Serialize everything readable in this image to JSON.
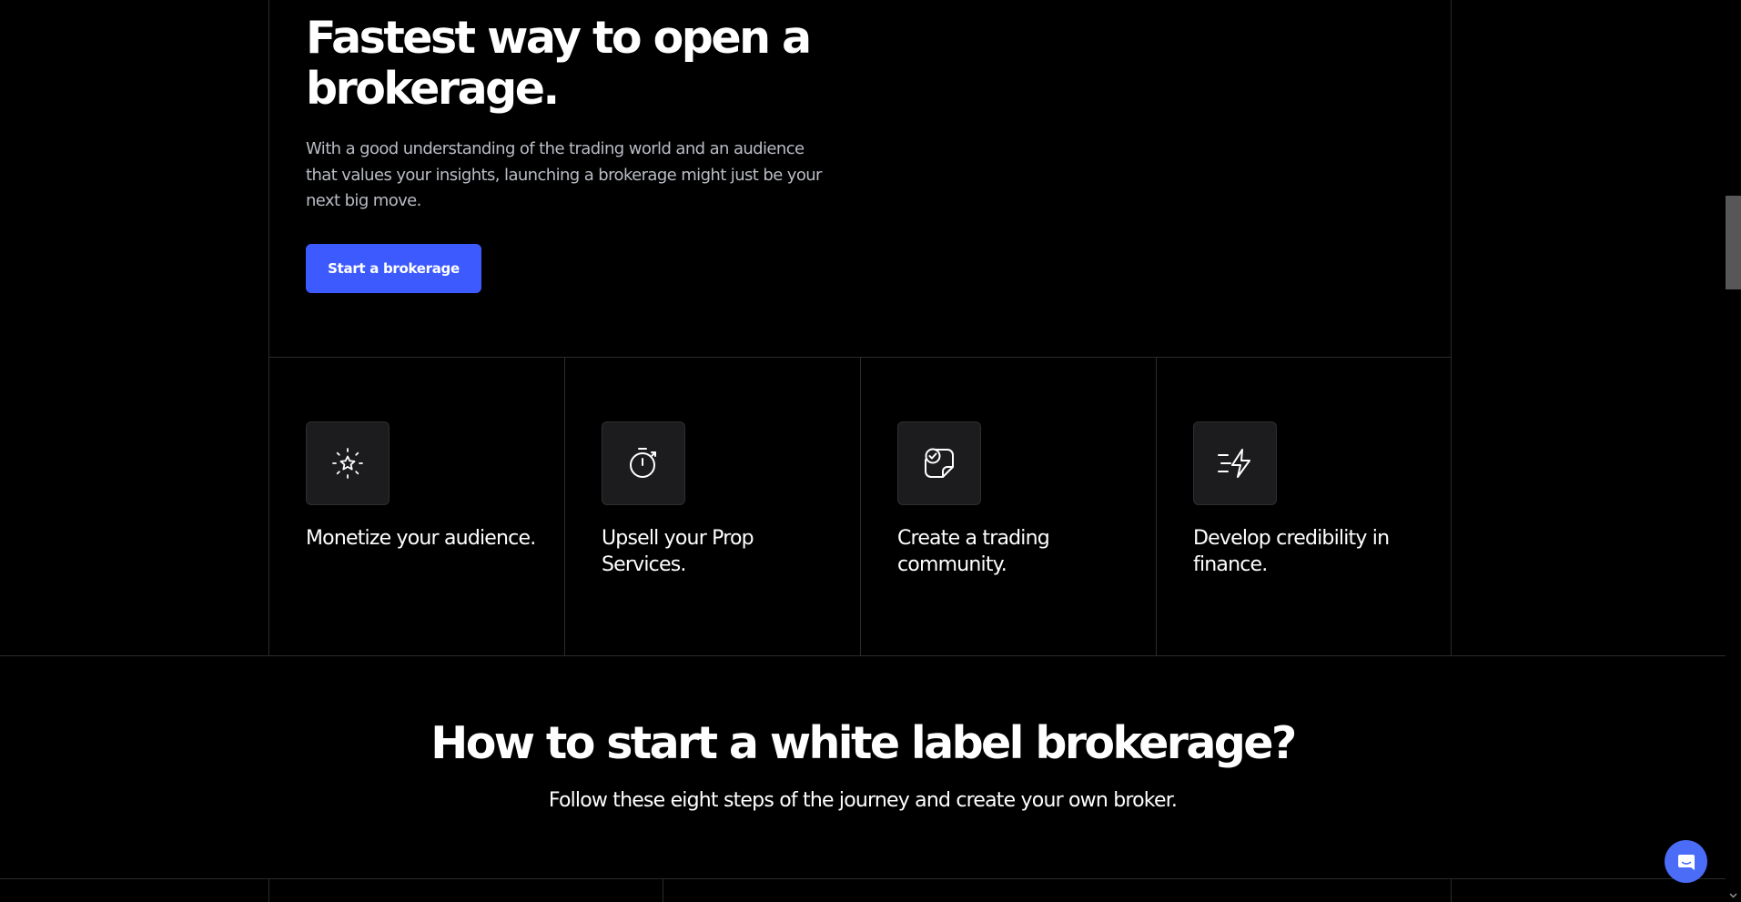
{
  "hero": {
    "title": "Fastest way to open a brokerage.",
    "description": "With a good understanding of the trading world and an audience that values your insights, launching a brokerage might just be your next big move.",
    "cta_label": "Start a brokerage"
  },
  "features": [
    {
      "icon": "sparkle-star-icon",
      "title": "Monetize your audience."
    },
    {
      "icon": "stopwatch-icon",
      "title": "Upsell your Prop Services."
    },
    {
      "icon": "community-note-icon",
      "title": "Create a trading community."
    },
    {
      "icon": "fast-lightning-icon",
      "title": "Develop credibility in finance."
    }
  ],
  "section": {
    "title": "How to start a white label brokerage?",
    "subtitle": "Follow these eight steps of the journey and create your own broker."
  },
  "chat": {
    "icon": "chat-bubble-icon"
  },
  "colors": {
    "background": "#000000",
    "accent": "#3d5afe",
    "chat_button": "#4a6cf7",
    "muted_text": "#b9bcc4",
    "grid_line": "#2b2b2b",
    "icon_tile": "#1c1c1e"
  }
}
